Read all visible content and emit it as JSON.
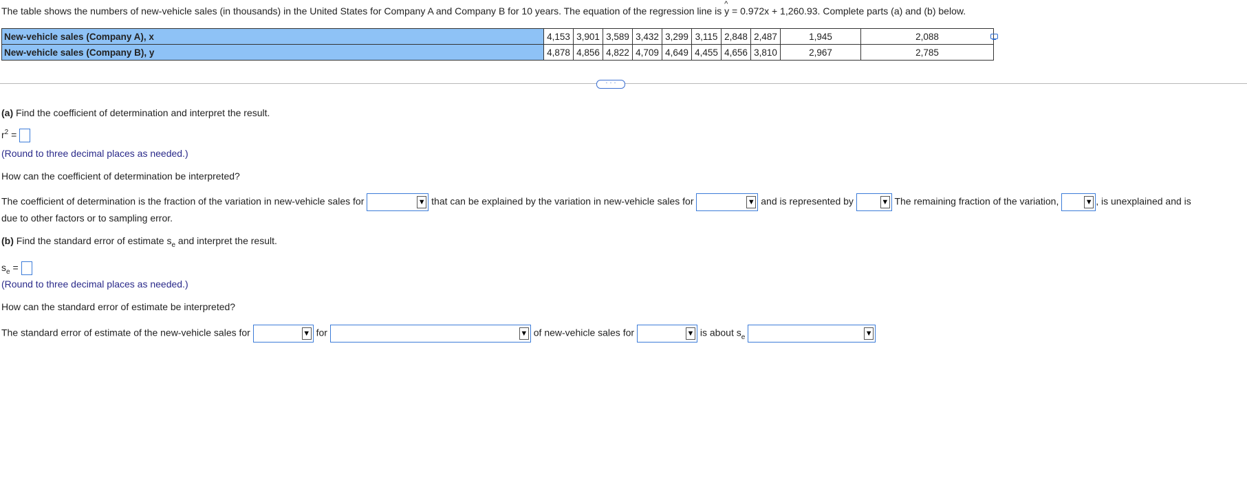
{
  "question": {
    "intro_prefix": "The table shows the numbers of new-vehicle sales (in thousands) in the United States for Company A and Company B for 10 years. The equation of the regression line is",
    "equation_y": "y",
    "equation_hat": "^",
    "equation_rest": "= 0.972x + 1,260.93. Complete parts (a) and (b) below."
  },
  "table": {
    "row_a_label": "New-vehicle sales (Company A), x",
    "row_b_label": "New-vehicle sales (Company B), y",
    "row_a_values": [
      "4,153",
      "3,901",
      "3,589",
      "3,432",
      "3,299",
      "3,115",
      "2,848",
      "2,487",
      "1,945",
      "2,088"
    ],
    "row_b_values": [
      "4,878",
      "4,856",
      "4,822",
      "4,709",
      "4,649",
      "4,455",
      "4,656",
      "3,810",
      "2,967",
      "2,785"
    ],
    "header_color": "#8ec2f6"
  },
  "icons": {
    "copy": "copy-icon",
    "more": "more-icon",
    "dropdown": "triangle-down-icon"
  },
  "more_button_label": "· · ·",
  "part_a": {
    "label_bold": "(a)",
    "label_text": "Find the coefficient of determination and interpret the result.",
    "r2_base": "r",
    "r2_sup": "2",
    "r2_equals": "=",
    "hint": "(Round to three decimal places as needed.)",
    "interpret_question": "How can the coefficient of determination be interpreted?",
    "sentence_1": "The coefficient of determination is the fraction of the variation in new-vehicle sales for",
    "sentence_2": "that can be explained by the variation in new-vehicle sales for",
    "sentence_3": "and is represented by",
    "sentence_4": "The remaining fraction of the variation,",
    "sentence_5": ", is unexplained and is",
    "sentence_6": "due to other factors or to sampling error."
  },
  "part_b": {
    "label_bold": "(b)",
    "label_text_1": "Find the standard error of estimate s",
    "label_sub": "e",
    "label_text_2": "and interpret the result.",
    "se_base": "s",
    "se_sub": "e",
    "se_equals": "=",
    "hint": "(Round to three decimal places as needed.)",
    "interpret_question": "How can the standard error of estimate be interpreted?",
    "sentence_1": "The standard error of estimate of the new-vehicle sales for",
    "sentence_2": "for",
    "sentence_3": "of new-vehicle sales for",
    "sentence_4": "is about s",
    "sentence_4_sub": "e"
  }
}
